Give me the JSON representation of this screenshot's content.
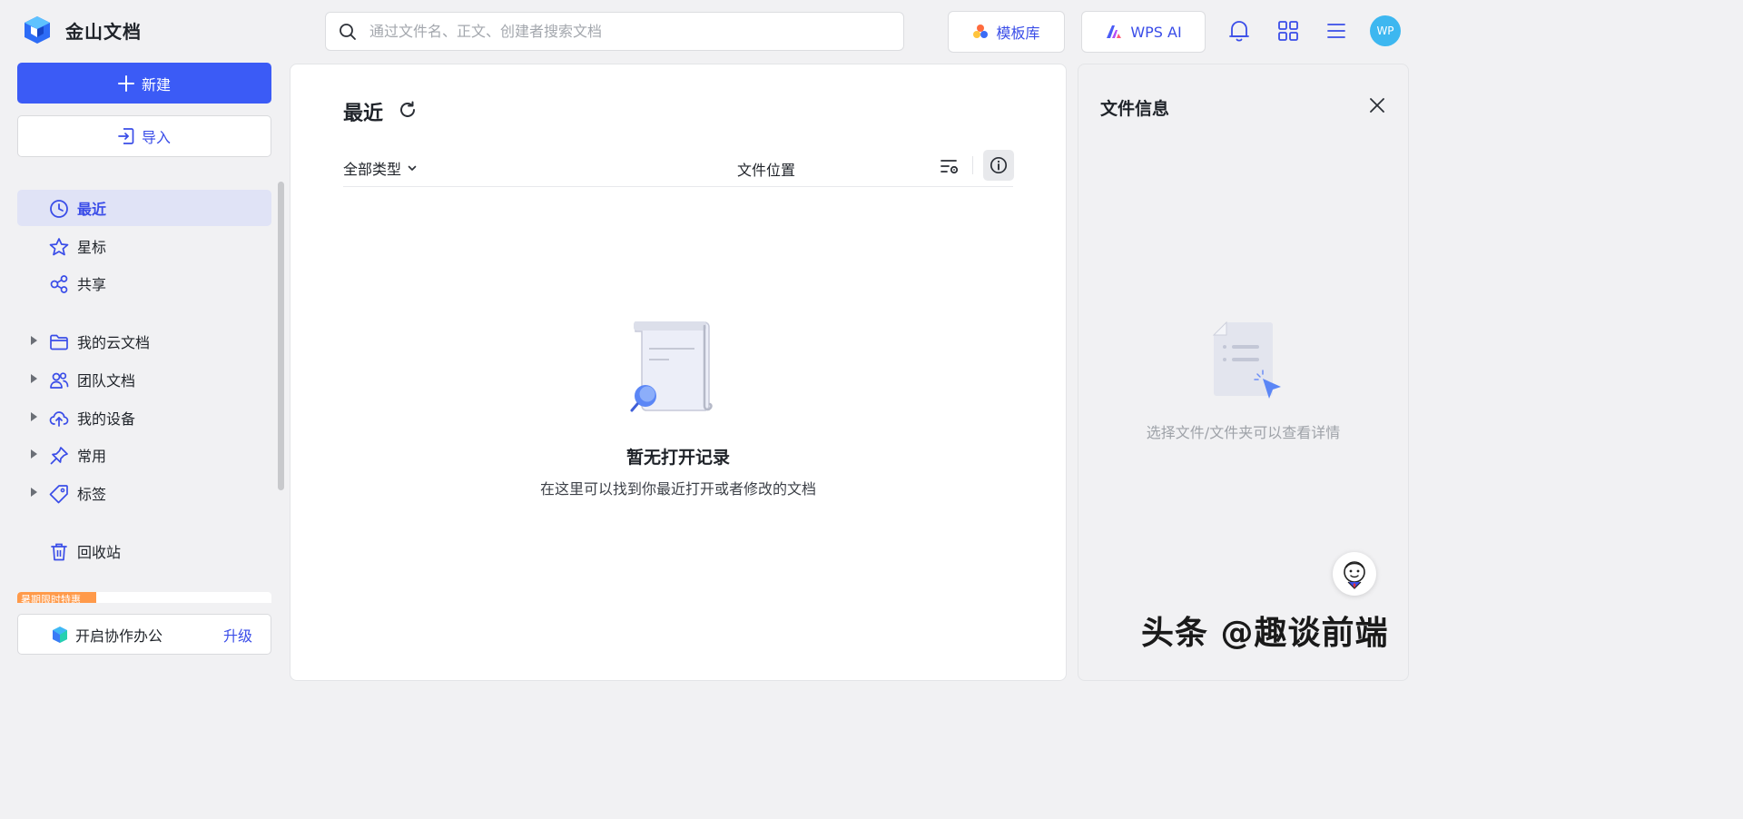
{
  "app": {
    "name": "金山文档"
  },
  "search": {
    "placeholder": "通过文件名、正文、创建者搜索文档"
  },
  "header": {
    "template_label": "模板库",
    "ai_label": "WPS AI",
    "avatar_text": "WP"
  },
  "sidebar": {
    "new_label": "新建",
    "import_label": "导入",
    "quick": [
      {
        "label": "最近",
        "icon": "clock-icon",
        "active": true
      },
      {
        "label": "星标",
        "icon": "star-icon"
      },
      {
        "label": "共享",
        "icon": "share-icon"
      }
    ],
    "folders": [
      {
        "label": "我的云文档",
        "icon": "folder-icon"
      },
      {
        "label": "团队文档",
        "icon": "team-icon"
      },
      {
        "label": "我的设备",
        "icon": "cloud-upload-icon"
      },
      {
        "label": "常用",
        "icon": "pin-icon"
      },
      {
        "label": "标签",
        "icon": "tag-icon"
      }
    ],
    "trash_label": "回收站",
    "promo_text": "暑期限时特惠",
    "collab_label": "开启协作办公",
    "upgrade_label": "升级"
  },
  "main": {
    "title": "最近",
    "filter_label": "全部类型",
    "location_header": "文件位置",
    "empty_title": "暂无打开记录",
    "empty_subtitle": "在这里可以找到你最近打开或者修改的文档"
  },
  "info_panel": {
    "title": "文件信息",
    "hint": "选择文件/文件夹可以查看详情"
  },
  "watermark": "头条 @趣谈前端",
  "colors": {
    "accent": "#3b5bf6",
    "link": "#3a4de8",
    "avatar": "#3db7f0",
    "active_bg": "#e0e3f6"
  }
}
